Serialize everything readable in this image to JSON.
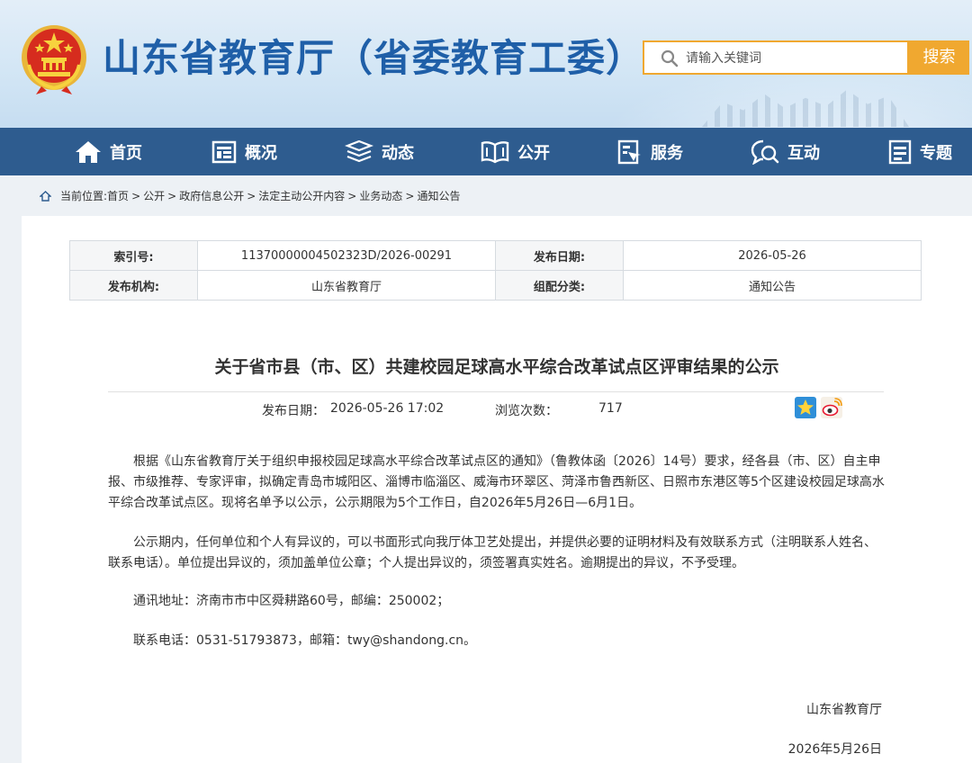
{
  "header": {
    "site_title": "山东省教育厅（省委教育工委）",
    "search_placeholder": "请输入关键词",
    "search_button": "搜索"
  },
  "nav": [
    {
      "label": "首页",
      "icon": "home-icon"
    },
    {
      "label": "概况",
      "icon": "overview-icon"
    },
    {
      "label": "动态",
      "icon": "news-stack-icon"
    },
    {
      "label": "公开",
      "icon": "open-book-icon"
    },
    {
      "label": "服务",
      "icon": "service-doc-icon"
    },
    {
      "label": "互动",
      "icon": "chat-search-icon"
    },
    {
      "label": "专题",
      "icon": "topic-doc-icon"
    }
  ],
  "breadcrumb": {
    "prefix": "当前位置:",
    "items": [
      "首页",
      "公开",
      "政府信息公开",
      "法定主动公开内容",
      "业务动态",
      "通知公告"
    ],
    "separator": ">"
  },
  "meta": {
    "index_label": "索引号:",
    "index_value": "11370000004502323D/2026-00291",
    "date_label": "发布日期:",
    "date_value": "2026-05-26",
    "org_label": "发布机构:",
    "org_value": "山东省教育厅",
    "category_label": "组配分类:",
    "category_value": "通知公告"
  },
  "article": {
    "title": "关于省市县（市、区）共建校园足球高水平综合改革试点区评审结果的公示",
    "pub_label": "发布日期：",
    "pub_datetime": "2026-05-26 17:02",
    "views_label": "浏览次数：",
    "views": "717",
    "paragraphs": [
      "根据《山东省教育厅关于组织申报校园足球高水平综合改革试点区的通知》（鲁教体函〔2026〕14号）要求，经各县（市、区）自主申报、市级推荐、专家评审，拟确定青岛市城阳区、淄博市临淄区、威海市环翠区、菏泽市鲁西新区、日照市东港区等5个区建设校园足球高水平综合改革试点区。现将名单予以公示，公示期限为5个工作日，自2026年5月26日—6月1日。",
      "公示期内，任何单位和个人有异议的，可以书面形式向我厅体卫艺处提出，并提供必要的证明材料及有效联系方式（注明联系人姓名、联系电话）。单位提出异议的，须加盖单位公章；个人提出异议的，须签署真实姓名。逾期提出的异议，不予受理。",
      "通讯地址：济南市市中区舜耕路60号，邮编：250002；",
      "联系电话：0531-51793873，邮箱：twy@shandong.cn。"
    ],
    "signature": "山东省教育厅",
    "sign_date": "2026年5月26日"
  },
  "colors": {
    "title_blue": "#1f5fa8",
    "nav_bg": "#2e5c8f",
    "accent_orange": "#f0a830"
  }
}
